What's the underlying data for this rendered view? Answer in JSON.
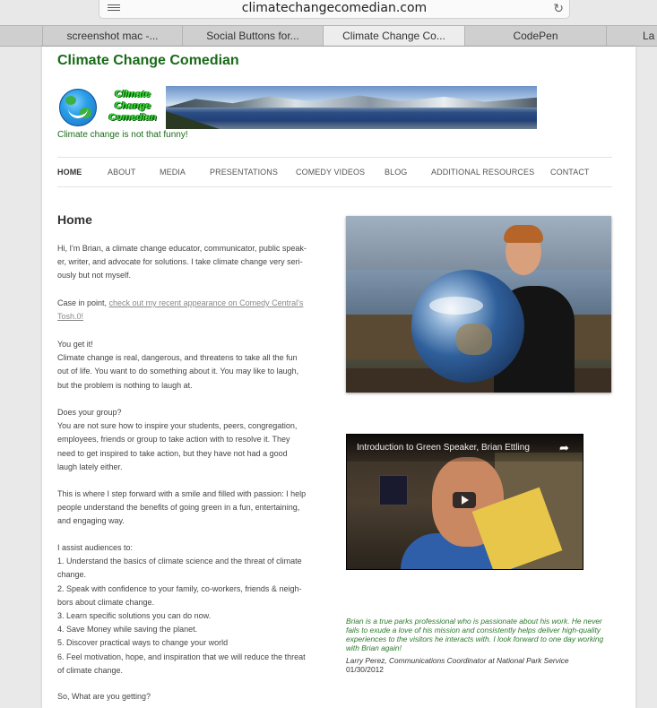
{
  "browser": {
    "url": "climatechangecomedian.com",
    "tabs": [
      {
        "label": "screenshot mac -..."
      },
      {
        "label": "Social Buttons for..."
      },
      {
        "label": "Climate Change Co...",
        "active": true
      },
      {
        "label": "CodePen"
      },
      {
        "label": "La"
      }
    ]
  },
  "site": {
    "title": "Climate Change Comedian",
    "logo_text": "Climate Change Comedian",
    "tagline": "Climate change is not that funny!"
  },
  "nav": {
    "items": [
      {
        "label": "HOME",
        "current": true
      },
      {
        "label": "ABOUT"
      },
      {
        "label": "MEDIA"
      },
      {
        "label": "PRESENTATIONS"
      },
      {
        "label": "COMEDY VIDEOS"
      },
      {
        "label": "BLOG"
      },
      {
        "label": "ADDITIONAL RESOURCES"
      },
      {
        "label": "CONTACT"
      }
    ]
  },
  "content": {
    "heading": "Home",
    "intro": "Hi, I'm Brian, a climate change educator, communicator, public speak-\ner, writer, and advocate for solutions. I take climate change very seri-\nously but not myself.",
    "case_prefix": "Case in point, ",
    "case_link": "check out my recent appearance on Comedy Central's\nTosh.0!",
    "you_get_it": "You get it!\nClimate change is real, dangerous, and threatens to take all the fun\nout of life. You want to do something about it. You may like to laugh,\nbut the problem is nothing to laugh at.",
    "group": "Does your group?\nYou are not sure how to inspire your students, peers, congregation,\nemployees, friends or group to take action with to resolve it. They\nneed to get inspired to take action, but they have not had a good\nlaugh lately either.",
    "step_forward": "This is where I step forward with a smile and filled with passion: I help\npeople understand the benefits of going green in a fun, entertaining,\nand engaging way.",
    "assist": "I assist audiences to:\n1. Understand the basics of climate science and the threat of climate\nchange.\n2. Speak with confidence to your family, co-workers, friends & neigh-\nbors about climate change.\n3. Learn specific solutions you can do now.\n4. Save Money while saving the planet.\n5. Discover practical ways to change your world\n6. Feel motivation, hope, and inspiration that we will reduce the threat\nof climate change.",
    "closing": "So, What are you getting?"
  },
  "video": {
    "title": "Introduction to Green Speaker, Brian Ettling"
  },
  "testimonial": {
    "quote": "Brian is a true parks professional who is passionate about his work. He never fails to exude a love of his mission and consistently helps deliver high-quality experiences to the visitors he interacts with. I look forward to one day working with Brian again!",
    "attribution": "Larry Perez, Communications Coordinator at National Park Service",
    "date": "01/30/2012"
  }
}
